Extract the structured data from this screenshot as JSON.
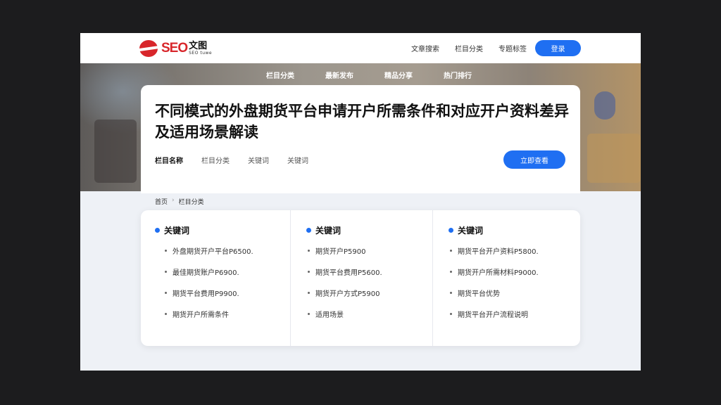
{
  "header": {
    "logo_text": "SEO",
    "logo_cn": "文图",
    "logo_sub": "SEO tuwe",
    "nav": [
      "文章搜索",
      "栏目分类",
      "专题标签"
    ],
    "cta": "登录"
  },
  "hero": {
    "subnav": [
      "栏目分类",
      "最新发布",
      "精品分享",
      "热门排行"
    ]
  },
  "article": {
    "title": "不同模式的外盘期货平台申请开户所需条件和对应开户资料差异及适用场景解读",
    "meta": [
      "栏目名称",
      "栏目分类",
      "关键词",
      "关键词"
    ],
    "cta": "立即查看"
  },
  "breadcrumb": [
    "首页",
    "栏目分类"
  ],
  "panel": {
    "columns": [
      {
        "title": "关键词",
        "items": [
          "外盘期货开户平台P6500.",
          "最佳期货账户P6900.",
          "期货平台费用P9900.",
          "期货开户所需条件"
        ]
      },
      {
        "title": "关键词",
        "items": [
          "期货开户P5900",
          "期货平台费用P5600.",
          "期货开户方式P5900",
          "适用场景"
        ]
      },
      {
        "title": "关键词",
        "items": [
          "期货平台开户资料P5800.",
          "期货开户所需材料P9000.",
          "期货平台优势",
          "期货平台开户流程说明"
        ]
      }
    ]
  },
  "colors": {
    "accent": "#1f6ff2",
    "brand": "#d8262b"
  },
  "icons": {
    "logo": "logo-icon",
    "col_dot": "dot-icon",
    "bullet": "bullet-icon"
  }
}
